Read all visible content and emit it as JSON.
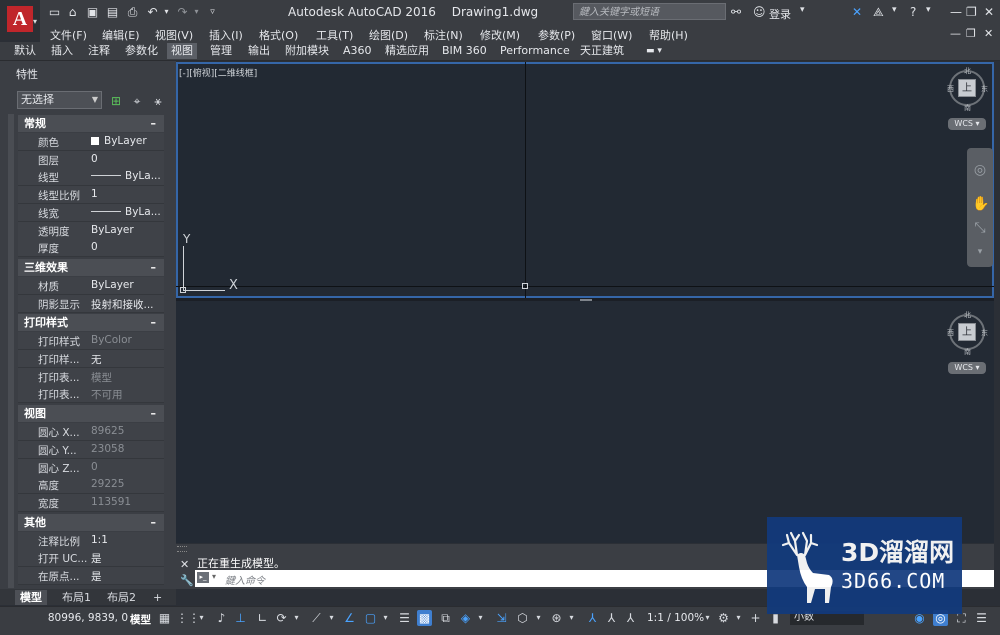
{
  "title_bar": {
    "product": "Autodesk AutoCAD 2016",
    "document": "Drawing1.dwg",
    "search_placeholder": "鍵入关键字或短语",
    "sign_in": "登录",
    "logo_letter": "A",
    "quick_access_icons": [
      "new-icon",
      "open-icon",
      "save-icon",
      "saveas-icon",
      "print-icon",
      "undo-icon",
      "redo-icon",
      "customize-icon"
    ],
    "right_icons": [
      "binoculars-icon",
      "user-icon",
      "exchange-icon",
      "a360-icon",
      "help-icon"
    ],
    "window_controls": [
      "—",
      "❐",
      "✕"
    ]
  },
  "menu_bar": {
    "items": [
      "文件(F)",
      "编辑(E)",
      "视图(V)",
      "插入(I)",
      "格式(O)",
      "工具(T)",
      "绘图(D)",
      "标注(N)",
      "修改(M)",
      "参数(P)",
      "窗口(W)",
      "帮助(H)"
    ],
    "doc_controls": [
      "—",
      "❐",
      "✕"
    ]
  },
  "ribbon_tabs": {
    "items": [
      "默认",
      "插入",
      "注释",
      "参数化",
      "视图",
      "管理",
      "输出",
      "附加模块",
      "A360",
      "精选应用",
      "BIM 360",
      "Performance",
      "天正建筑"
    ],
    "active_index": 4
  },
  "properties": {
    "title": "特性",
    "selection": "无选择",
    "sections": [
      {
        "name": "常规",
        "toggle": "–",
        "rows": [
          {
            "key": "颜色",
            "value": "ByLayer",
            "swatch": "#ffffff"
          },
          {
            "key": "图层",
            "value": "0"
          },
          {
            "key": "线型",
            "value": "ByLa...",
            "line": true
          },
          {
            "key": "线型比例",
            "value": "1"
          },
          {
            "key": "线宽",
            "value": "ByLa...",
            "line": true
          },
          {
            "key": "透明度",
            "value": "ByLayer"
          },
          {
            "key": "厚度",
            "value": "0"
          }
        ]
      },
      {
        "name": "三维效果",
        "toggle": "–",
        "rows": [
          {
            "key": "材质",
            "value": "ByLayer"
          },
          {
            "key": "阴影显示",
            "value": "投射和接收..."
          }
        ]
      },
      {
        "name": "打印样式",
        "toggle": "–",
        "rows": [
          {
            "key": "打印样式",
            "value": "ByColor",
            "dim": true
          },
          {
            "key": "打印样...",
            "value": "无"
          },
          {
            "key": "打印表...",
            "value": "模型",
            "dim": true
          },
          {
            "key": "打印表...",
            "value": "不可用",
            "dim": true
          }
        ]
      },
      {
        "name": "视图",
        "toggle": "–",
        "rows": [
          {
            "key": "圆心 X...",
            "value": "89625",
            "dim": true
          },
          {
            "key": "圆心 Y...",
            "value": "23058",
            "dim": true
          },
          {
            "key": "圆心 Z...",
            "value": "0",
            "dim": true
          },
          {
            "key": "高度",
            "value": "29225",
            "dim": true
          },
          {
            "key": "宽度",
            "value": "113591",
            "dim": true
          }
        ]
      },
      {
        "name": "其他",
        "toggle": "–",
        "rows": [
          {
            "key": "注释比例",
            "value": "1:1"
          },
          {
            "key": "打开 UC...",
            "value": "是"
          },
          {
            "key": "在原点...",
            "value": "是"
          }
        ]
      }
    ]
  },
  "layout_tabs": {
    "items": [
      "模型",
      "布局1",
      "布局2"
    ],
    "add": "+",
    "active_index": 0
  },
  "viewport": {
    "label": "[-][俯视][二维线框]",
    "ucs_x": "X",
    "ucs_y": "Y",
    "viewcube_face": "上",
    "viewcube_dirs": {
      "n": "北",
      "s": "南",
      "e": "东",
      "w": "西"
    },
    "wcs": "WCS"
  },
  "command_line": {
    "history": "正在重生成模型。",
    "placeholder": "鍵入命令",
    "prompt_icon": "▸_"
  },
  "status_bar": {
    "coordinates": "80996, 9839, 0",
    "model": "模型",
    "scale": "1:1 / 100%",
    "units": "小数"
  },
  "watermark": {
    "line1": "3D溜溜网",
    "line2": "3D66.COM"
  },
  "colors": {
    "accent": "#3566a8",
    "logo_red": "#c0262b",
    "status_on": "#4aa3ff",
    "watermark_blue": "#123a7d"
  }
}
